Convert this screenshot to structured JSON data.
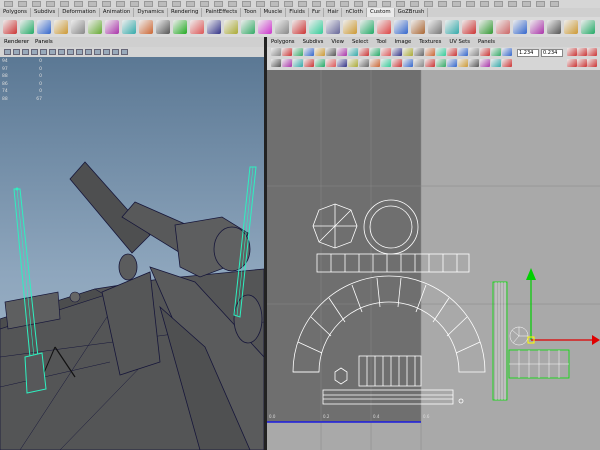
{
  "shelf": {
    "tabs": [
      "Polygons",
      "Subdivs",
      "Deformation",
      "Animation",
      "Dynamics",
      "Rendering",
      "PaintEffects",
      "Toon",
      "Muscle",
      "Fluids",
      "Fur",
      "Hair",
      "nCloth",
      "Custom",
      "GoZBrush"
    ],
    "active_tab": "Custom"
  },
  "left_panel": {
    "menu": [
      "Renderer",
      "Panels"
    ],
    "hud_rows": [
      [
        "94",
        "0"
      ],
      [
        "97",
        "0"
      ],
      [
        "88",
        "0"
      ],
      [
        "86",
        "0"
      ],
      [
        "74",
        "0"
      ],
      [
        "88",
        "67"
      ]
    ]
  },
  "uv_editor": {
    "menu": [
      "Polygons",
      "Subdivs",
      "View",
      "Select",
      "Tool",
      "Image",
      "Textures",
      "UV Sets",
      "Panels"
    ],
    "u_value": "1.234",
    "v_value": "0.234",
    "grid_labels": [
      "0.0",
      "0.2",
      "0.4",
      "0.6"
    ]
  },
  "colors": {
    "viewport_top": "#5b7894",
    "viewport_bottom": "#a8bccd",
    "uv_background": "#a9a9a9",
    "uv_dark_region": "#6f6f6f",
    "wire_selected": "#2ef0c0",
    "manip_up": "#00d000",
    "manip_right": "#e00000"
  }
}
